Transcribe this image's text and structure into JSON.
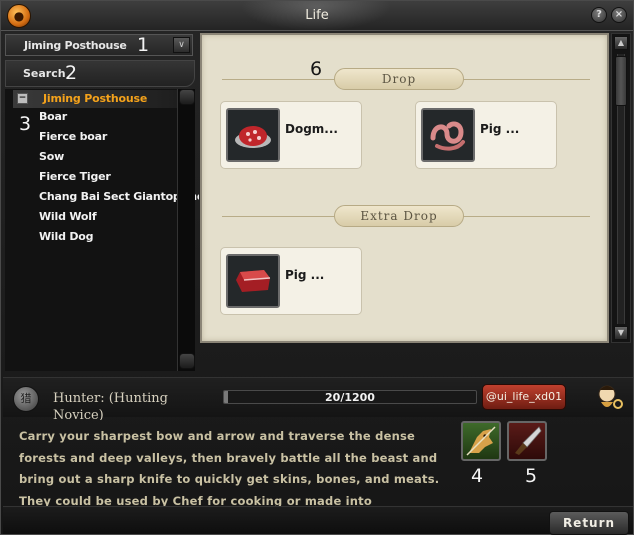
{
  "window": {
    "title": "Life"
  },
  "title_buttons": {
    "help": "?",
    "close": "×"
  },
  "location_dropdown": {
    "value": "Jiming Posthouse",
    "arrow": "∨"
  },
  "search": {
    "label": "Search"
  },
  "tree": {
    "collapse_symbol": "−",
    "header": "Jiming Posthouse",
    "items": [
      {
        "label": "Boar"
      },
      {
        "label": "Fierce boar"
      },
      {
        "label": "Sow"
      },
      {
        "label": "Fierce Tiger"
      },
      {
        "label": "Chang Bai Sect Giantopithecu"
      },
      {
        "label": "Wild Wolf"
      },
      {
        "label": "Wild Dog"
      }
    ]
  },
  "callouts": [
    "1",
    "2",
    "3",
    "4",
    "5",
    "6"
  ],
  "drop_panel": {
    "drop_header": "Drop",
    "extra_drop_header": "Extra Drop",
    "drops": [
      {
        "name": "Dogm...",
        "icon": "dog-meat-icon"
      },
      {
        "name": "Pig ...",
        "icon": "pig-intestine-icon"
      }
    ],
    "extra_drops": [
      {
        "name": "Pig ...",
        "icon": "pig-meat-icon"
      }
    ]
  },
  "job": {
    "icon_glyph": "猎",
    "title": "Hunter: (Hunting Novice)",
    "progress_text": "20/1200",
    "progress_fraction": 0.0167,
    "tag_button": "@ui_life_xd01"
  },
  "description": "Carry your sharpest bow and arrow and traverse the dense forests and deep valleys, then bravely battle all the beast and bring out a sharp knife to quickly get skins, bones, and meats. They could be used by Chef for cooking or made into equipments.",
  "skills": [
    {
      "icon": "hunting-skill-icon"
    },
    {
      "icon": "skinning-knife-skill-icon"
    }
  ],
  "footer": {
    "return_label": "Return"
  },
  "colors": {
    "accent": "#f4a21b",
    "panel": "#e4dfcc",
    "tag": "#a33425"
  }
}
